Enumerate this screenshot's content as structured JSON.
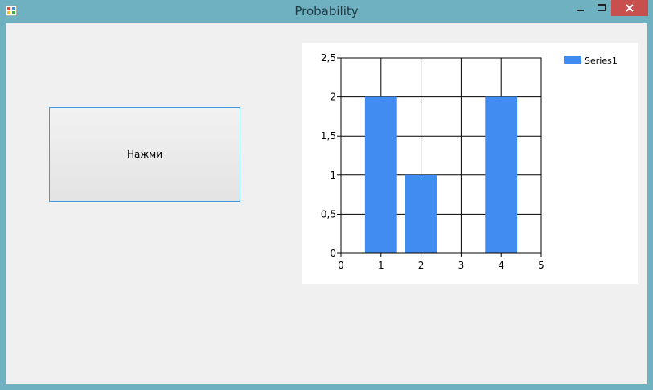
{
  "window": {
    "title": "Probability",
    "controls": {
      "minimize_icon": "minimize-icon",
      "maximize_icon": "maximize-icon",
      "close_icon": "close-icon"
    }
  },
  "main_button": {
    "label": "Нажми"
  },
  "colors": {
    "titlebar": "#6fb1c0",
    "close": "#c7504f",
    "series": "#418cf0",
    "button_border": "#3c9be0"
  },
  "chart_data": {
    "type": "bar",
    "x": [
      1,
      2,
      4
    ],
    "values": [
      2,
      1,
      2
    ],
    "xlim": [
      0,
      5
    ],
    "ylim": [
      0,
      2.5
    ],
    "xticks": [
      "0",
      "1",
      "2",
      "3",
      "4",
      "5"
    ],
    "yticks": [
      "0",
      "0,5",
      "1",
      "1,5",
      "2",
      "2,5"
    ],
    "series": [
      {
        "name": "Series1",
        "values": [
          2,
          1,
          2
        ]
      }
    ],
    "legend": "top-right",
    "grid": true
  }
}
